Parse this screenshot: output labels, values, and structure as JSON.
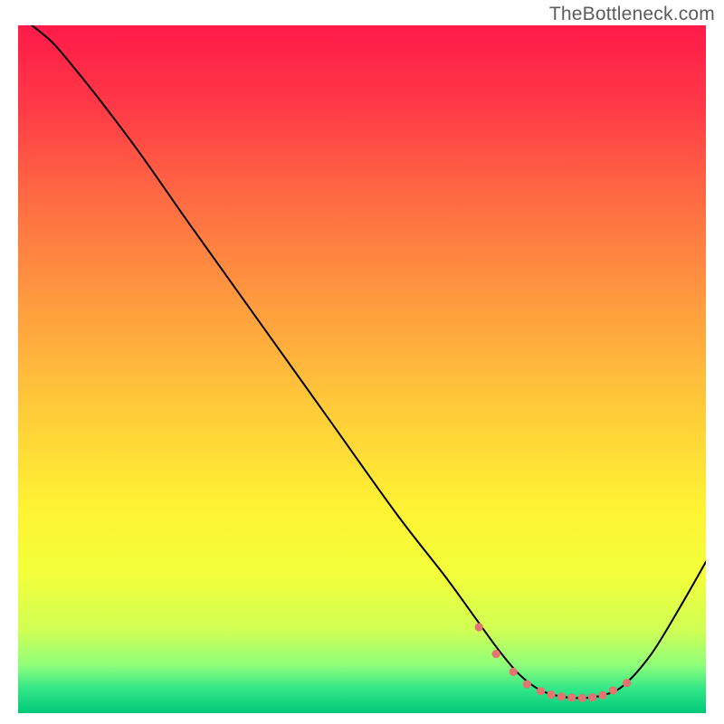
{
  "watermark": "TheBottleneck.com",
  "chart_data": {
    "type": "line",
    "title": "",
    "xlabel": "",
    "ylabel": "",
    "xlim": [
      0,
      100
    ],
    "ylim": [
      0,
      100
    ],
    "grid": false,
    "background_gradient_stops": [
      {
        "offset": 0.0,
        "color": "#ff1a49"
      },
      {
        "offset": 0.12,
        "color": "#ff3a47"
      },
      {
        "offset": 0.25,
        "color": "#ff6a43"
      },
      {
        "offset": 0.4,
        "color": "#ff9a3f"
      },
      {
        "offset": 0.55,
        "color": "#ffc93a"
      },
      {
        "offset": 0.7,
        "color": "#fff233"
      },
      {
        "offset": 0.8,
        "color": "#f2ff3a"
      },
      {
        "offset": 0.88,
        "color": "#d0ff55"
      },
      {
        "offset": 0.93,
        "color": "#8fff7a"
      },
      {
        "offset": 0.965,
        "color": "#33e688"
      },
      {
        "offset": 1.0,
        "color": "#00c878"
      }
    ],
    "series": [
      {
        "name": "bottleneck-curve",
        "color": "#000000",
        "stroke_width": 2,
        "x": [
          2.0,
          5.0,
          8.0,
          12.0,
          18.0,
          25.0,
          35.0,
          45.0,
          55.0,
          62.0,
          66.0,
          70.0,
          73.0,
          76.0,
          79.0,
          82.0,
          85.0,
          88.0,
          92.0,
          96.0,
          100.0
        ],
        "y": [
          100.0,
          97.5,
          94.0,
          89.0,
          81.0,
          71.0,
          57.0,
          43.0,
          29.0,
          20.0,
          14.5,
          9.0,
          5.5,
          3.3,
          2.4,
          2.2,
          2.6,
          4.0,
          8.5,
          15.0,
          22.0
        ]
      }
    ],
    "markers": {
      "name": "optimal-range",
      "color": "#e4746f",
      "radius": 4.6,
      "x": [
        67.0,
        69.5,
        72.0,
        74.0,
        76.0,
        77.5,
        79.0,
        80.5,
        82.0,
        83.5,
        85.0,
        86.5,
        88.5
      ],
      "y": [
        12.5,
        8.6,
        6.0,
        4.2,
        3.2,
        2.7,
        2.4,
        2.25,
        2.2,
        2.3,
        2.6,
        3.3,
        4.4
      ]
    }
  }
}
